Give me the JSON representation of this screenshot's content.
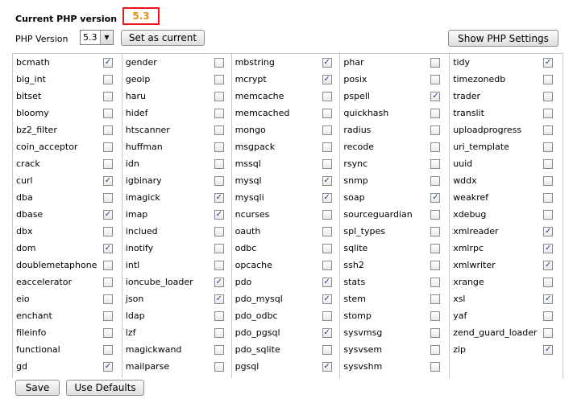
{
  "header": {
    "current_label": "Current PHP version",
    "current_value": "5.3",
    "version_label": "PHP Version",
    "version_selected": "5.3",
    "set_current_label": "Set as current",
    "show_settings_label": "Show PHP Settings"
  },
  "footer": {
    "save_label": "Save",
    "defaults_label": "Use Defaults"
  },
  "columns": [
    {
      "items": [
        {
          "name": "bcmath",
          "checked": true
        },
        {
          "name": "big_int",
          "checked": false
        },
        {
          "name": "bitset",
          "checked": false
        },
        {
          "name": "bloomy",
          "checked": false
        },
        {
          "name": "bz2_filter",
          "checked": false
        },
        {
          "name": "coin_acceptor",
          "checked": false
        },
        {
          "name": "crack",
          "checked": false
        },
        {
          "name": "curl",
          "checked": true
        },
        {
          "name": "dba",
          "checked": false
        },
        {
          "name": "dbase",
          "checked": true
        },
        {
          "name": "dbx",
          "checked": false
        },
        {
          "name": "dom",
          "checked": true
        },
        {
          "name": "doublemetaphone",
          "checked": false
        },
        {
          "name": "eaccelerator",
          "checked": false
        },
        {
          "name": "eio",
          "checked": false
        },
        {
          "name": "enchant",
          "checked": false
        },
        {
          "name": "fileinfo",
          "checked": false
        },
        {
          "name": "functional",
          "checked": false
        },
        {
          "name": "gd",
          "checked": true
        }
      ]
    },
    {
      "items": [
        {
          "name": "gender",
          "checked": false
        },
        {
          "name": "geoip",
          "checked": false
        },
        {
          "name": "haru",
          "checked": false
        },
        {
          "name": "hidef",
          "checked": false
        },
        {
          "name": "htscanner",
          "checked": false
        },
        {
          "name": "huffman",
          "checked": false
        },
        {
          "name": "idn",
          "checked": false
        },
        {
          "name": "igbinary",
          "checked": false
        },
        {
          "name": "imagick",
          "checked": true
        },
        {
          "name": "imap",
          "checked": true
        },
        {
          "name": "inclued",
          "checked": false
        },
        {
          "name": "inotify",
          "checked": false
        },
        {
          "name": "intl",
          "checked": false
        },
        {
          "name": "ioncube_loader",
          "checked": true
        },
        {
          "name": "json",
          "checked": true
        },
        {
          "name": "ldap",
          "checked": false
        },
        {
          "name": "lzf",
          "checked": false
        },
        {
          "name": "magickwand",
          "checked": false
        },
        {
          "name": "mailparse",
          "checked": false
        }
      ]
    },
    {
      "items": [
        {
          "name": "mbstring",
          "checked": true
        },
        {
          "name": "mcrypt",
          "checked": true
        },
        {
          "name": "memcache",
          "checked": false
        },
        {
          "name": "memcached",
          "checked": false
        },
        {
          "name": "mongo",
          "checked": false
        },
        {
          "name": "msgpack",
          "checked": false
        },
        {
          "name": "mssql",
          "checked": false
        },
        {
          "name": "mysql",
          "checked": true
        },
        {
          "name": "mysqli",
          "checked": true
        },
        {
          "name": "ncurses",
          "checked": false
        },
        {
          "name": "oauth",
          "checked": false
        },
        {
          "name": "odbc",
          "checked": false
        },
        {
          "name": "opcache",
          "checked": false
        },
        {
          "name": "pdo",
          "checked": true
        },
        {
          "name": "pdo_mysql",
          "checked": true
        },
        {
          "name": "pdo_odbc",
          "checked": false
        },
        {
          "name": "pdo_pgsql",
          "checked": true
        },
        {
          "name": "pdo_sqlite",
          "checked": false
        },
        {
          "name": "pgsql",
          "checked": true
        }
      ]
    },
    {
      "items": [
        {
          "name": "phar",
          "checked": false
        },
        {
          "name": "posix",
          "checked": false
        },
        {
          "name": "pspell",
          "checked": true
        },
        {
          "name": "quickhash",
          "checked": false
        },
        {
          "name": "radius",
          "checked": false
        },
        {
          "name": "recode",
          "checked": false
        },
        {
          "name": "rsync",
          "checked": false
        },
        {
          "name": "snmp",
          "checked": false
        },
        {
          "name": "soap",
          "checked": true
        },
        {
          "name": "sourceguardian",
          "checked": false
        },
        {
          "name": "spl_types",
          "checked": false
        },
        {
          "name": "sqlite",
          "checked": false
        },
        {
          "name": "ssh2",
          "checked": false
        },
        {
          "name": "stats",
          "checked": false
        },
        {
          "name": "stem",
          "checked": false
        },
        {
          "name": "stomp",
          "checked": false
        },
        {
          "name": "sysvmsg",
          "checked": false
        },
        {
          "name": "sysvsem",
          "checked": false
        },
        {
          "name": "sysvshm",
          "checked": false
        }
      ]
    },
    {
      "items": [
        {
          "name": "tidy",
          "checked": true
        },
        {
          "name": "timezonedb",
          "checked": false
        },
        {
          "name": "trader",
          "checked": false
        },
        {
          "name": "translit",
          "checked": false
        },
        {
          "name": "uploadprogress",
          "checked": false
        },
        {
          "name": "uri_template",
          "checked": false
        },
        {
          "name": "uuid",
          "checked": false
        },
        {
          "name": "wddx",
          "checked": false
        },
        {
          "name": "weakref",
          "checked": false
        },
        {
          "name": "xdebug",
          "checked": false
        },
        {
          "name": "xmlreader",
          "checked": true
        },
        {
          "name": "xmlrpc",
          "checked": true
        },
        {
          "name": "xmlwriter",
          "checked": true
        },
        {
          "name": "xrange",
          "checked": false
        },
        {
          "name": "xsl",
          "checked": true
        },
        {
          "name": "yaf",
          "checked": false
        },
        {
          "name": "zend_guard_loader",
          "checked": false
        },
        {
          "name": "zip",
          "checked": true
        }
      ]
    }
  ]
}
